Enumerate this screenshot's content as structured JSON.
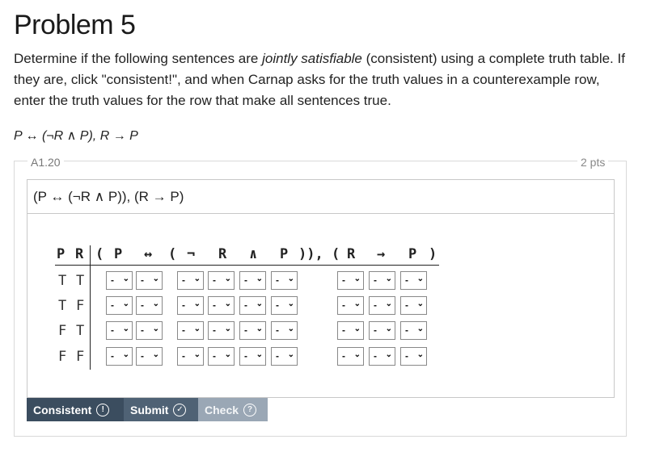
{
  "page": {
    "title": "Problem 5",
    "desc_before": "Determine if the following sentences are ",
    "desc_em": "jointly satisfiable",
    "desc_after": " (consistent) using a complete truth table. If they are, click \"consistent!\", and when Carnap asks for the truth values in a counterexample row, enter the truth values for the row that make all sentences true.",
    "formula": "P ↔ (¬R ∧ P), R → P"
  },
  "problem": {
    "id": "A1.20",
    "points": "2 pts",
    "sentence": "(P ↔ (¬R ∧ P)), (R → P)"
  },
  "table": {
    "headers": [
      "P",
      "R",
      "(",
      "P",
      "↔",
      "(",
      "¬",
      "R",
      "∧",
      "P",
      ")),",
      "(",
      "R",
      "→",
      "P",
      ")"
    ],
    "rows": [
      {
        "vals": [
          "T",
          "T"
        ],
        "cells": [
          "-",
          "-",
          "-",
          "-",
          "-",
          "-",
          "-",
          "-",
          "-"
        ]
      },
      {
        "vals": [
          "T",
          "F"
        ],
        "cells": [
          "-",
          "-",
          "-",
          "-",
          "-",
          "-",
          "-",
          "-",
          "-"
        ]
      },
      {
        "vals": [
          "F",
          "T"
        ],
        "cells": [
          "-",
          "-",
          "-",
          "-",
          "-",
          "-",
          "-",
          "-",
          "-"
        ]
      },
      {
        "vals": [
          "F",
          "F"
        ],
        "cells": [
          "-",
          "-",
          "-",
          "-",
          "-",
          "-",
          "-",
          "-",
          "-"
        ]
      }
    ],
    "caret": "⌄"
  },
  "buttons": {
    "consistent": "Consistent",
    "consistent_icon": "!",
    "submit": "Submit",
    "submit_icon": "✓",
    "check": "Check",
    "check_icon": "?"
  },
  "icons": {
    "consistent": "exclamation-circle-icon",
    "submit": "check-circle-icon",
    "check": "question-circle-icon"
  }
}
